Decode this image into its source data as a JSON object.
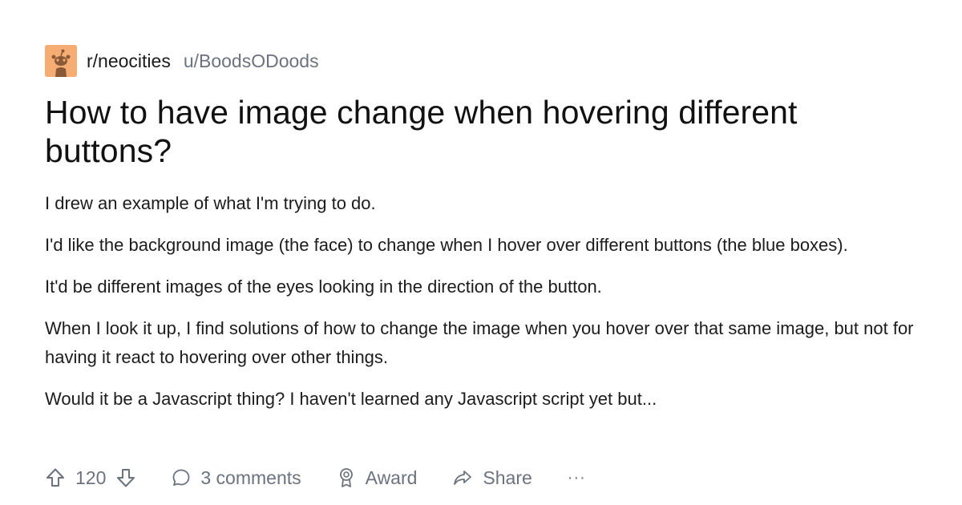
{
  "post": {
    "community": "r/neocities",
    "author": "u/BoodsODoods",
    "title": "How to have image change when hovering different buttons?",
    "paragraphs": [
      "I drew an example of what I'm trying to do.",
      "I'd like the background image (the face) to change when I hover over different  buttons (the blue boxes).",
      "It'd be different  images of the eyes looking in the direction of the button.",
      "When I look it up, I find solutions of how to change the image when you hover over that same image, but not for having it react to hovering over other things.",
      "Would it be a Javascript thing? I haven't learned any Javascript script yet but..."
    ]
  },
  "actions": {
    "votes": "120",
    "comments": "3 comments",
    "award": "Award",
    "share": "Share",
    "more": "···"
  },
  "icons": {
    "avatar": "community-avatar",
    "upvote": "upvote-arrow-icon",
    "downvote": "downvote-arrow-icon",
    "comments": "speech-bubble-icon",
    "award": "award-ribbon-icon",
    "share": "share-arrow-icon"
  },
  "colors": {
    "avatar_bg": "#f6ad74",
    "muted_text": "#6b7280",
    "primary_text": "#1a1a1b"
  }
}
